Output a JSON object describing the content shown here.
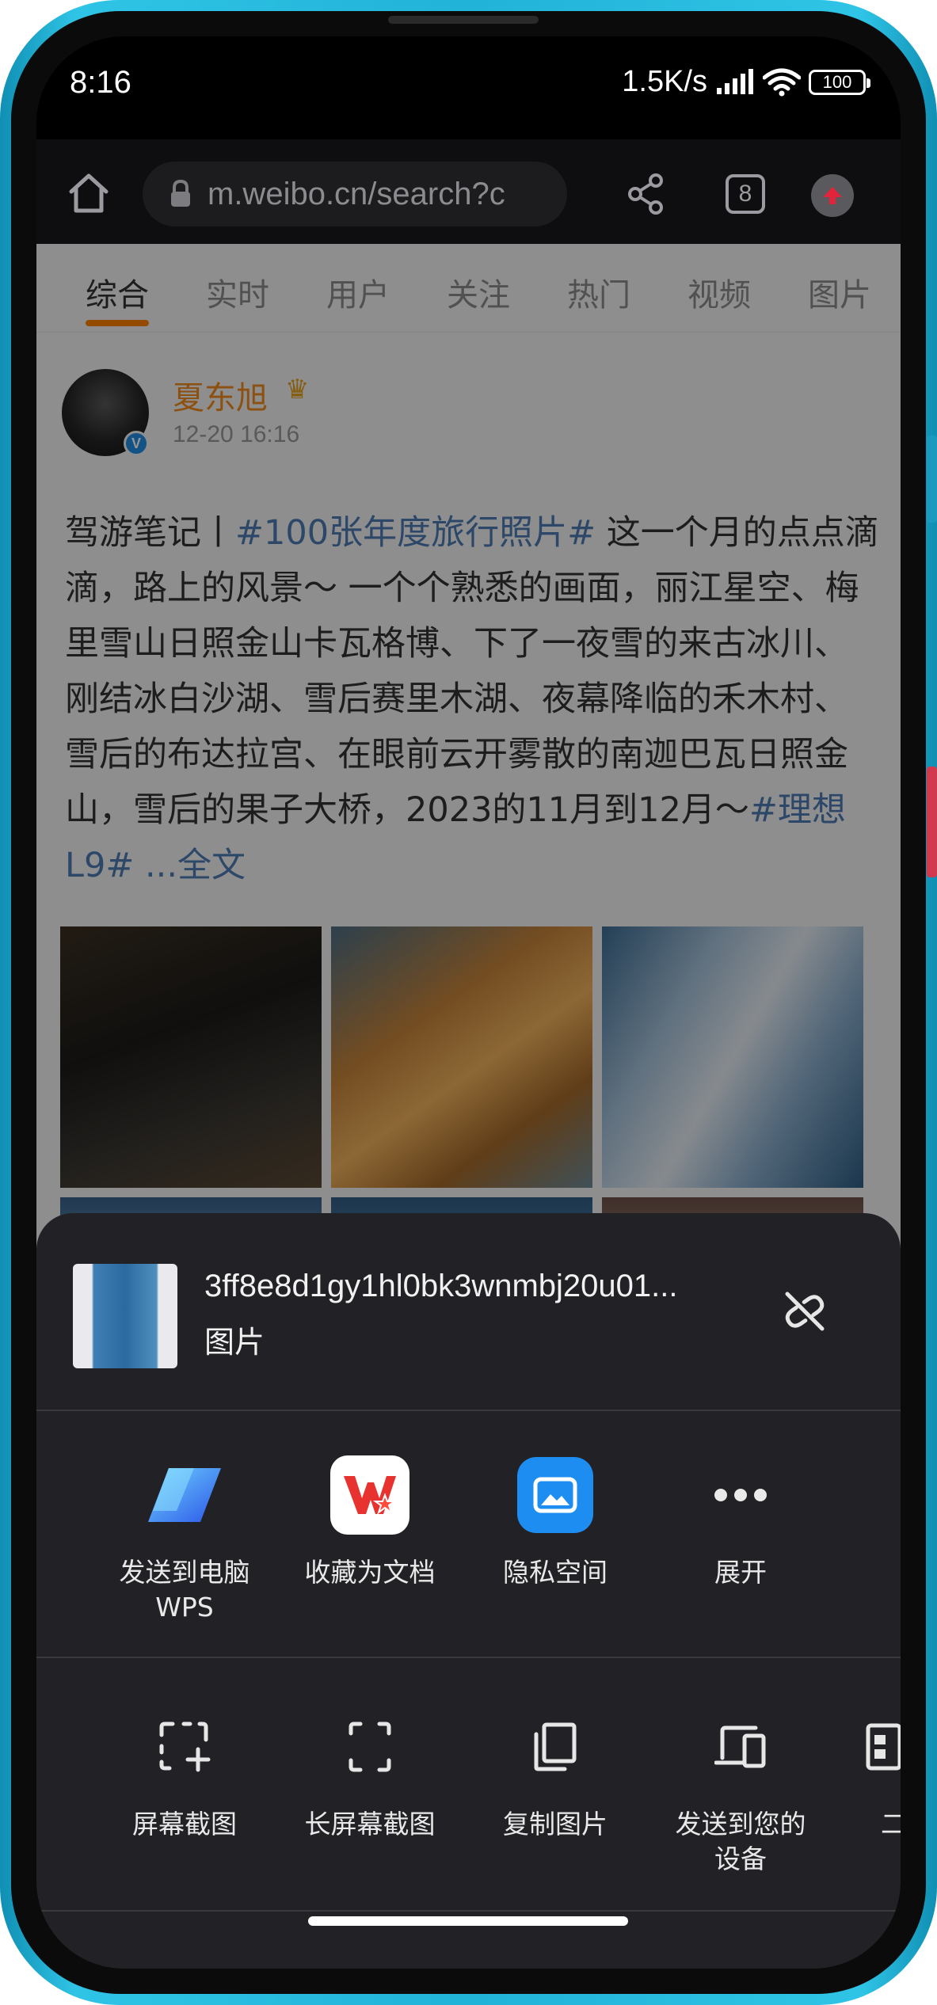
{
  "status_bar": {
    "time": "8:16",
    "net_speed": "1.5K/s",
    "battery": "100"
  },
  "browser": {
    "url": "m.weibo.cn/search?c",
    "tab_count": "8"
  },
  "weibo": {
    "tabs": [
      "综合",
      "实时",
      "用户",
      "关注",
      "热门",
      "视频",
      "图片"
    ],
    "active_tab": "综合",
    "post": {
      "author": "夏东旭",
      "time": "12-20 16:16",
      "text_segments": [
        {
          "t": "驾游笔记丨",
          "tag": false
        },
        {
          "t": "#100张年度旅行照片#",
          "tag": true
        },
        {
          "t": " 这一个月的点点滴滴，路上的风景～ 一个个熟悉的画面，丽江星空、梅里雪山日照金山卡瓦格博、下了一夜雪的来古冰川、刚结冰白沙湖、雪后赛里木湖、夜幕降临的禾木村、雪后的布达拉宫、在眼前云开雾散的南迦巴瓦日照金山，雪后的果子大桥，2023的11月到12月～",
          "tag": false
        },
        {
          "t": "#理想L9#",
          "tag": true
        },
        {
          "t": " ...全文",
          "tag": true
        }
      ]
    }
  },
  "share_sheet": {
    "file_name": "3ff8e8d1gy1hl0bk3wnmbj20u01...",
    "file_type": "图片",
    "apps": [
      {
        "label": "发送到电脑\nWPS",
        "icon": "wps-send-icon"
      },
      {
        "label": "收藏为文档",
        "icon": "wps-office-icon"
      },
      {
        "label": "隐私空间",
        "icon": "private-space-icon"
      },
      {
        "label": "展开",
        "icon": "more-icon"
      }
    ],
    "actions": [
      {
        "label": "屏幕截图",
        "icon": "screenshot-icon"
      },
      {
        "label": "长屏幕截图",
        "icon": "long-screenshot-icon"
      },
      {
        "label": "复制图片",
        "icon": "copy-image-icon"
      },
      {
        "label": "发送到您的\n设备",
        "icon": "send-to-device-icon"
      },
      {
        "label": "二维",
        "icon": "qr-code-icon"
      }
    ]
  },
  "colors": {
    "accent_orange": "#ff8200",
    "tag_blue": "#4c7bb3",
    "frame_cyan": "#22b3d8",
    "sheet_bg": "#222226"
  }
}
